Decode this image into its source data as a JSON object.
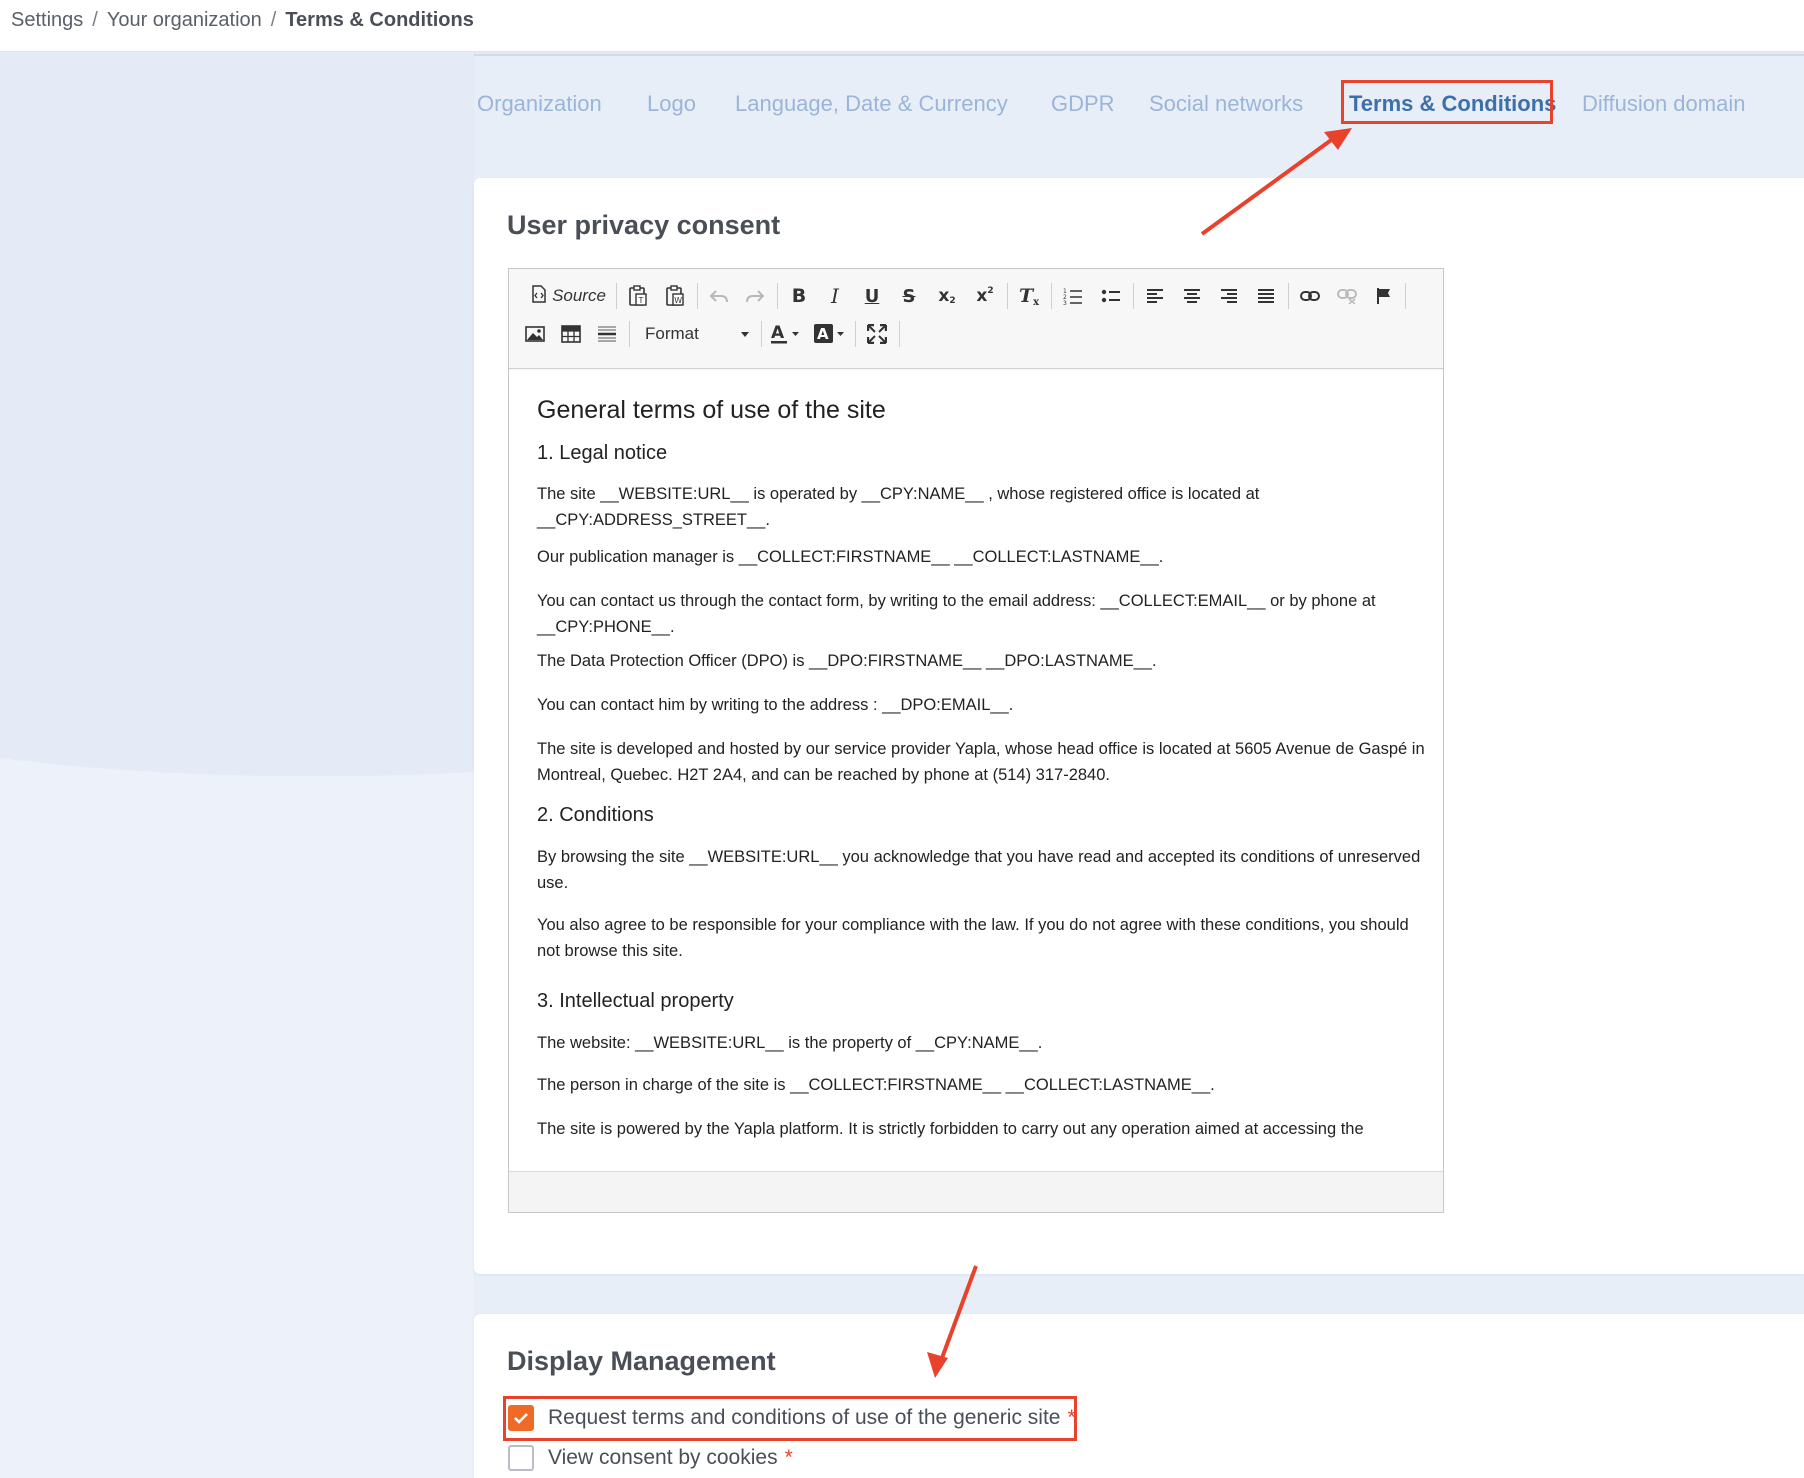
{
  "breadcrumb": {
    "items": [
      "Settings",
      "Your organization"
    ],
    "current": "Terms & Conditions"
  },
  "tabs": [
    {
      "label": "Organization",
      "active": false
    },
    {
      "label": "Logo",
      "active": false
    },
    {
      "label": "Language, Date & Currency",
      "active": false
    },
    {
      "label": "GDPR",
      "active": false
    },
    {
      "label": "Social networks",
      "active": false
    },
    {
      "label": "Terms & Conditions",
      "active": true
    },
    {
      "label": "Diffusion domain",
      "active": false
    }
  ],
  "privacy_card": {
    "title": "User privacy consent"
  },
  "editor": {
    "toolbar": {
      "source_label": "Source",
      "format_label": "Format",
      "icons": [
        "source-icon",
        "paste-text-icon",
        "paste-word-icon",
        "undo-icon",
        "redo-icon",
        "bold-icon",
        "italic-icon",
        "underline-icon",
        "strikethrough-icon",
        "subscript-icon",
        "superscript-icon",
        "remove-format-icon",
        "numbered-list-icon",
        "bulleted-list-icon",
        "align-left-icon",
        "align-center-icon",
        "align-right-icon",
        "justify-icon",
        "link-icon",
        "unlink-icon",
        "anchor-icon",
        "image-icon",
        "table-icon",
        "horizontal-rule-icon",
        "text-color-icon",
        "background-color-icon",
        "maximize-icon"
      ]
    },
    "content": {
      "heading": "General terms of use of the site",
      "s1_title": "1. Legal notice",
      "s1_p1": "The site __WEBSITE:URL__ is operated by __CPY:NAME__ , whose registered office is located at __CPY:ADDRESS_STREET__.",
      "s1_p2": "Our publication manager is __COLLECT:FIRSTNAME__ __COLLECT:LASTNAME__.",
      "s1_p3": "You can contact us through the contact form, by writing to the email address: __COLLECT:EMAIL__ or by phone at __CPY:PHONE__.",
      "s1_p4": "The Data Protection Officer (DPO) is __DPO:FIRSTNAME__ __DPO:LASTNAME__.",
      "s1_p5": "You can contact him by writing to the address : __DPO:EMAIL__.",
      "s1_p6": "The site is developed and hosted by our service provider Yapla, whose head office is located at 5605 Avenue de Gaspé  in Montreal, Quebec. H2T 2A4, and can be reached by phone at (514) 317-2840.",
      "s2_title": "2. Conditions",
      "s2_p1": "By browsing the site __WEBSITE:URL__ you acknowledge that you have read and accepted its conditions of unreserved use.",
      "s2_p2": "You also agree to be responsible for your compliance with the law. If you do not agree with these conditions, you should not  browse this site.",
      "s3_title": "3. Intellectual property",
      "s3_p1": "The website: __WEBSITE:URL__ is the property of __CPY:NAME__.",
      "s3_p2": "The person in charge of the site is __COLLECT:FIRSTNAME__ __COLLECT:LASTNAME__.",
      "s3_p3": "The site is powered by the Yapla platform. It is strictly forbidden to carry out any operation aimed at accessing the"
    }
  },
  "display_card": {
    "title": "Display Management",
    "options": [
      {
        "label": "Request terms and conditions of use of the generic site",
        "checked": true,
        "required_mark": "*"
      },
      {
        "label": "View consent by cookies",
        "checked": false,
        "required_mark": "*"
      }
    ]
  },
  "colors": {
    "accent_orange": "#ee6a25",
    "highlight_red": "#e8412c",
    "tab_active": "#3d6fab",
    "tab_inactive": "#9ab5d8",
    "page_bg": "#e8eef8"
  }
}
